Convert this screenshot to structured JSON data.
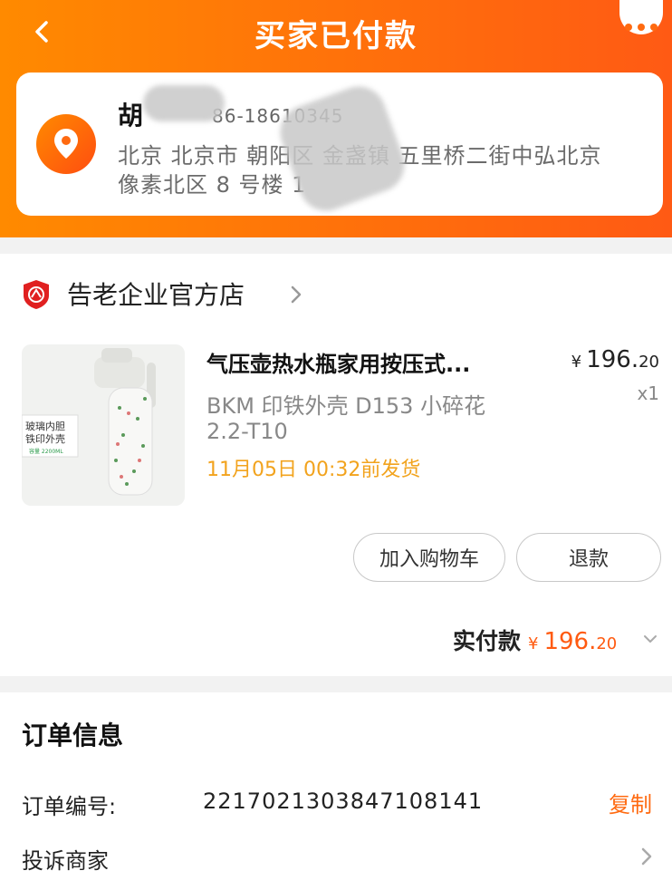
{
  "header": {
    "title": "买家已付款",
    "back_icon": "chevron-left-icon",
    "more_icon": "more-dots-icon",
    "bg_colors": [
      "#ff8a00",
      "#ff5a14"
    ]
  },
  "address": {
    "name": "胡",
    "phone": "86-18610345",
    "line1": "北京 北京市 朝阳区 金盏镇 五里桥二街中弘北京",
    "line2": "像素北区 8 号楼 1",
    "icon": "location-pin-icon"
  },
  "store": {
    "name": "告老企业官方店",
    "icon": "enterprise-shield-icon"
  },
  "product": {
    "title": "气压壶热水瓶家用按压式...",
    "spec_line1": "BKM 印铁外壳 D153 小碎花",
    "spec_line2": "2.2-T10",
    "ship_time": "11月05日 00:32前发货",
    "price_currency": "¥",
    "price_int": "196.",
    "price_dec": "20",
    "quantity": "x1",
    "image_label_1": "玻璃内胆",
    "image_label_2": "铁印外壳",
    "image_label_3": "容量 2200ML"
  },
  "actions": {
    "add_to_cart": "加入购物车",
    "refund": "退款"
  },
  "payment": {
    "label": "实付款",
    "currency": "¥",
    "amount_int": "196.",
    "amount_dec": "20"
  },
  "order_info": {
    "section_title": "订单信息",
    "number_label": "订单编号:",
    "number_value": "2217021303847108141",
    "copy_label": "复制",
    "complain_label": "投诉商家"
  },
  "colors": {
    "accent": "#ff5a10",
    "ship_time": "#f2a31d"
  }
}
